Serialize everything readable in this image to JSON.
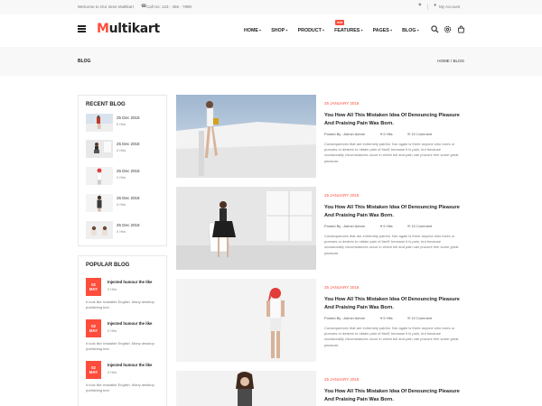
{
  "topbar": {
    "welcome": "Welcome to Our store Multikart",
    "call": "Call Us: 123 - 456 - 7890",
    "account": "My Account"
  },
  "header": {
    "logo_m": "M",
    "logo_rest": "ultikart",
    "nav": [
      {
        "label": "HOME",
        "caret": "+"
      },
      {
        "label": "SHOP",
        "caret": "+"
      },
      {
        "label": "PRODUCT",
        "caret": "+"
      },
      {
        "label": "FEATURES",
        "caret": "+",
        "badge": "new"
      },
      {
        "label": "PAGES",
        "caret": "+"
      },
      {
        "label": "BLOG",
        "caret": "+"
      }
    ]
  },
  "breadcrumb": {
    "title": "BLOG",
    "path": "HOME  /  BLOG"
  },
  "sidebar": {
    "recent_title": "RECENT BLOG",
    "recent": [
      {
        "date": "25 Dec 2018",
        "hits": "0 Hits"
      },
      {
        "date": "25 Dec 2018",
        "hits": "0 Hits"
      },
      {
        "date": "25 Dec 2018",
        "hits": "0 Hits"
      },
      {
        "date": "25 Dec 2018",
        "hits": "0 Hits"
      },
      {
        "date": "25 Dec 2018",
        "hits": "0 Hits"
      }
    ],
    "popular_title": "POPULAR BLOG",
    "popular": [
      {
        "day": "02",
        "month": "MAY",
        "title": "Injected humour the like",
        "hits": "0 Hits",
        "desc": "It look like readable English. Many desktop publishing text."
      },
      {
        "day": "02",
        "month": "MAY",
        "title": "Injected humour the like",
        "hits": "0 Hits",
        "desc": "It look like readable English. Many desktop publishing text."
      },
      {
        "day": "02",
        "month": "MAY",
        "title": "Injected humour the like",
        "hits": "0 Hits",
        "desc": "It look like readable English. Many desktop publishing text."
      }
    ]
  },
  "posts": [
    {
      "date": "25 JANUARY 2018",
      "title": "You How All This Mistaken Idea Of Denouncing Pleasure And Praising Pain Was Born.",
      "author": "Posted By : Admin Admin",
      "hits": "5 Hits",
      "comments": "10 Comment",
      "desc": "Consequences that are extremely painful. Nor again is there anyone who loves or pursues or desires to obtain pain of itself, because it is pain, but because occasionally circumstances occur in which toil and pain can procure him some great pleasure."
    },
    {
      "date": "25 JANUARY 2018",
      "title": "You How All This Mistaken Idea Of Denouncing Pleasure And Praising Pain Was Born.",
      "author": "Posted By : Admin Admin",
      "hits": "5 Hits",
      "comments": "10 Comment",
      "desc": "Consequences that are extremely painful. Nor again is there anyone who loves or pursues or desires to obtain pain of itself, because it is pain, but because occasionally circumstances occur in which toil and pain can procure him some great pleasure."
    },
    {
      "date": "25 JANUARY 2018",
      "title": "You How All This Mistaken Idea Of Denouncing Pleasure And Praising Pain Was Born.",
      "author": "Posted By : Admin Admin",
      "hits": "5 Hits",
      "comments": "10 Comment",
      "desc": "Consequences that are extremely painful. Nor again is there anyone who loves or pursues or desires to obtain pain of itself, because it is pain, but because occasionally circumstances occur in which toil and pain can procure him some great pleasure."
    },
    {
      "date": "25 JANUARY 2018",
      "title": "You How All This Mistaken Idea Of Denouncing Pleasure And Praising Pain Was Born.",
      "author": "",
      "hits": "",
      "comments": "",
      "desc": ""
    }
  ],
  "colors": {
    "accent": "#ff4c3b",
    "topbar_bg": "#f8f8f8",
    "breadcrumb_bg": "#f8f8f8"
  },
  "icons": [
    "menu-icon",
    "phone-icon",
    "heart-icon",
    "user-icon",
    "search-icon",
    "gear-icon",
    "cart-icon",
    "comment-icon"
  ]
}
